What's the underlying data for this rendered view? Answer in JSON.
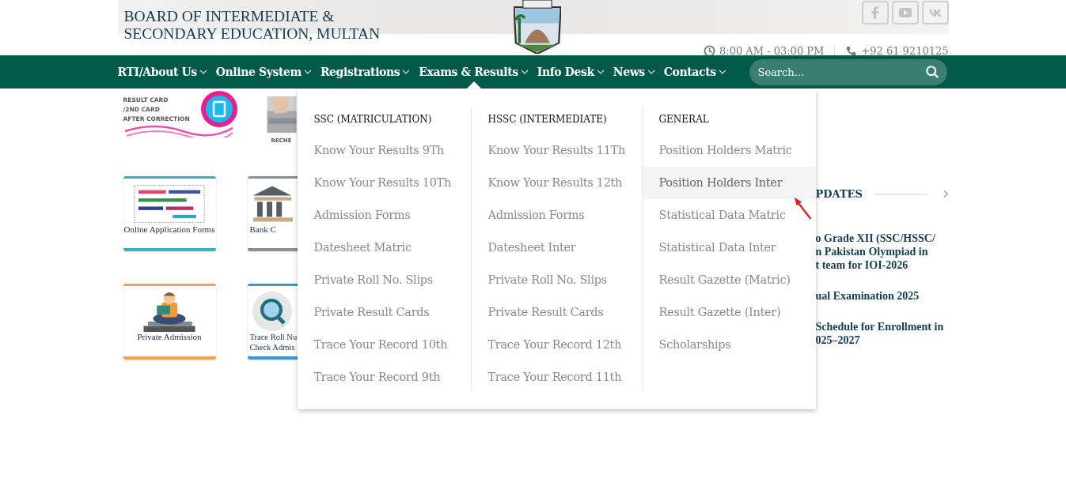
{
  "header": {
    "title_lines": [
      "BOARD OF INTERMEDIATE &",
      "SECONDARY EDUCATION, MULTAN"
    ],
    "social": [
      {
        "kind": "facebook"
      },
      {
        "kind": "youtube"
      },
      {
        "kind": "vk"
      }
    ],
    "contact": {
      "hours": "8:00 AM - 03:00 PM",
      "phone": "+92 61 9210125"
    }
  },
  "nav": {
    "items": [
      {
        "label": "RTI/About Us",
        "selected": false
      },
      {
        "label": "Online System",
        "selected": false
      },
      {
        "label": "Registrations",
        "selected": false
      },
      {
        "label": "Exams & Results",
        "selected": true
      },
      {
        "label": "Info Desk",
        "selected": false
      },
      {
        "label": "News",
        "selected": false
      },
      {
        "label": "Contacts",
        "selected": false
      }
    ],
    "search": {
      "placeholder": "Search..."
    }
  },
  "tiles": [
    {
      "kind": "result-card",
      "lines": [
        "RESULT CARD",
        "/2ND CARD",
        "AFTER CORRECTION"
      ]
    },
    {
      "kind": "keyboard",
      "lines": [
        "RECHE"
      ]
    },
    {
      "kind": "forms",
      "lines": [
        "Online Application Forms"
      ]
    },
    {
      "kind": "bank",
      "lines": [
        "Bank C"
      ]
    },
    {
      "kind": "reader",
      "lines": [
        "Private Admission"
      ]
    },
    {
      "kind": "search",
      "lines": [
        "Trace Roll Nu",
        "Check Admis"
      ]
    }
  ],
  "dropdown": {
    "columns": [
      {
        "heading": "SSC (MATRICULATION)",
        "items": [
          {
            "label": "Know Your Results 9Th",
            "selected": false
          },
          {
            "label": "Know Your Results 10Th",
            "selected": false
          },
          {
            "label": "Admission Forms",
            "selected": false
          },
          {
            "label": "Datesheet Matric",
            "selected": false
          },
          {
            "label": "Private Roll No. Slips",
            "selected": false
          },
          {
            "label": "Private Result Cards",
            "selected": false
          },
          {
            "label": "Trace Your Record 10th",
            "selected": false
          },
          {
            "label": "Trace Your Record 9th",
            "selected": false
          }
        ]
      },
      {
        "heading": "HSSC (INTERMEDIATE)",
        "items": [
          {
            "label": "Know Your Results 11Th",
            "selected": false
          },
          {
            "label": "Know Your Results 12th",
            "selected": false
          },
          {
            "label": "Admission Forms",
            "selected": false
          },
          {
            "label": "Datesheet Inter",
            "selected": false
          },
          {
            "label": "Private Roll No. Slips",
            "selected": false
          },
          {
            "label": "Private Result Cards",
            "selected": false
          },
          {
            "label": "Trace Your Record 12th",
            "selected": false
          },
          {
            "label": "Trace Your Record 11th",
            "selected": false
          }
        ]
      },
      {
        "heading": "GENERAL",
        "items": [
          {
            "label": "Position Holders Matric",
            "selected": false
          },
          {
            "label": "Position Holders Inter",
            "selected": true
          },
          {
            "label": "Statistical Data Matric",
            "selected": false
          },
          {
            "label": "Statistical Data Inter",
            "selected": false
          },
          {
            "label": "Result Gazette (Matric)",
            "selected": false
          },
          {
            "label": "Result Gazette (Inter)",
            "selected": false
          },
          {
            "label": "Scholarships",
            "selected": false
          }
        ]
      }
    ]
  },
  "updates": {
    "title": "PDATES",
    "items": [
      "o Grade XII (SSC/HSSC/\nn Pakistan Olympiad in\nt team for IOI-2026",
      "ual Examination 2025",
      "Schedule for Enrollment in\n025–2027"
    ]
  }
}
